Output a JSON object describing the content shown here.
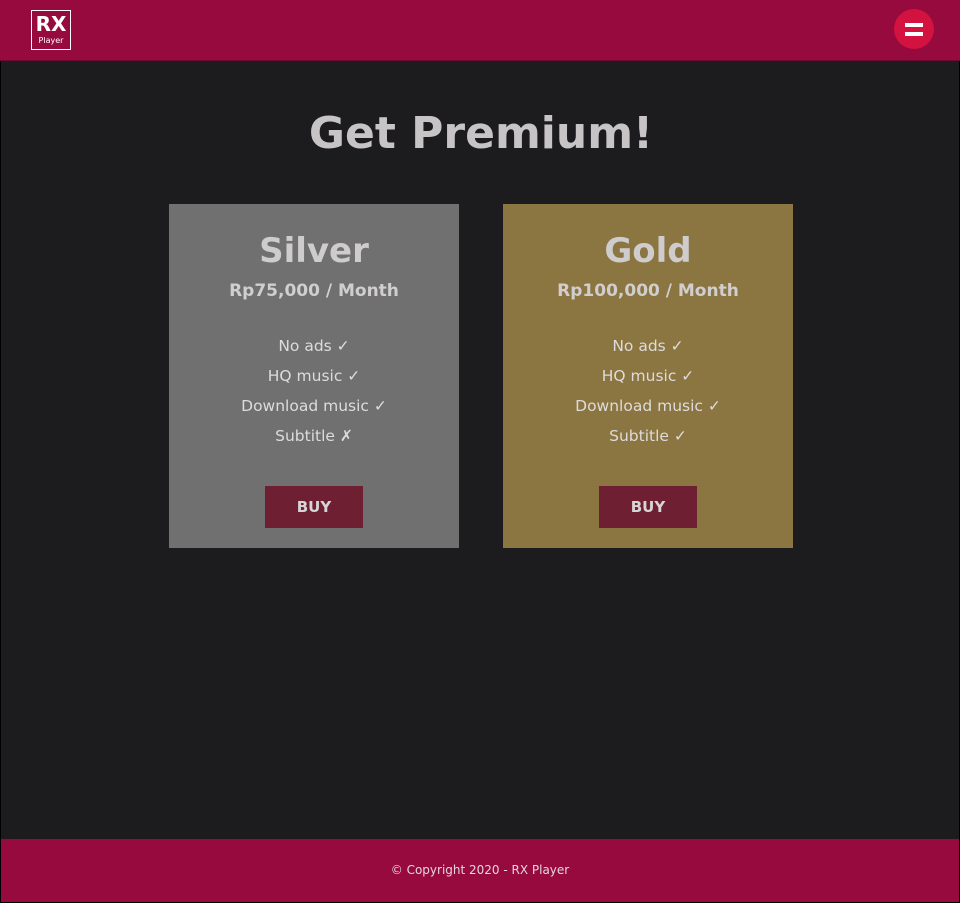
{
  "header": {
    "logo": {
      "main": "RX",
      "sub": "Player"
    },
    "menu_icon": "hamburger-menu-icon"
  },
  "main": {
    "title": "Get Premium!",
    "plans": [
      {
        "name": "Silver",
        "price": "Rp75,000 / Month",
        "background": "#707070",
        "features": [
          "No ads ✓",
          "HQ music ✓",
          "Download music ✓",
          "Subtitle ✗"
        ],
        "button_label": "BUY"
      },
      {
        "name": "Gold",
        "price": "Rp100,000 / Month",
        "background": "#8b7540",
        "features": [
          "No ads ✓",
          "HQ music ✓",
          "Download music ✓",
          "Subtitle ✓"
        ],
        "button_label": "BUY"
      }
    ]
  },
  "footer": {
    "text": "© Copyright 2020 - RX Player"
  },
  "colors": {
    "brand": "#970a3e",
    "menu_button": "#d3123f",
    "page_background": "#1c1b1d",
    "buy_button": "#6e1f32"
  }
}
